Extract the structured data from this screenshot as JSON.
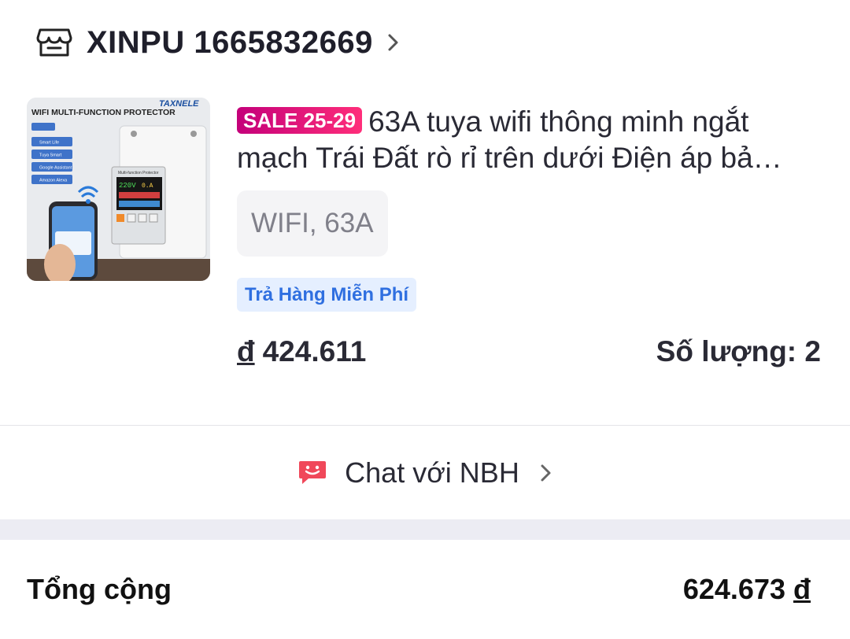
{
  "shop": {
    "icon": "store-icon",
    "name": "XINPU 1665832669"
  },
  "product": {
    "sale_badge": "SALE 25-29",
    "title": "63A tuya wifi thông minh ngắt mạch Trái Đất rò rỉ trên dưới Điện áp bả…",
    "variant": "WIFI, 63A",
    "free_return": "Trả Hàng Miễn Phí",
    "currency": "đ",
    "price": "424.611",
    "quantity_label": "Số lượng: 2",
    "image_text": {
      "banner": "WIFI MULTI-FUNCTION PROTECTOR",
      "brand": "TAXNELE",
      "device_label": "Multi-function Protector",
      "reading_voltage": "220V",
      "reading_current": "0.A",
      "apps": [
        "Smart Life",
        "Tuya Smart",
        "Google Assistant",
        "Amazon Alexa"
      ]
    }
  },
  "chat": {
    "icon": "chat-bubble-icon",
    "label": "Chat với NBH"
  },
  "total": {
    "label": "Tổng cộng",
    "value": "624.673",
    "currency": "đ"
  },
  "colors": {
    "sale_badge_start": "#c4007a",
    "sale_badge_end": "#ff2e7a",
    "free_return_text": "#2f6fe0",
    "free_return_bg": "#e5efff",
    "chat_icon": "#f0485a"
  }
}
